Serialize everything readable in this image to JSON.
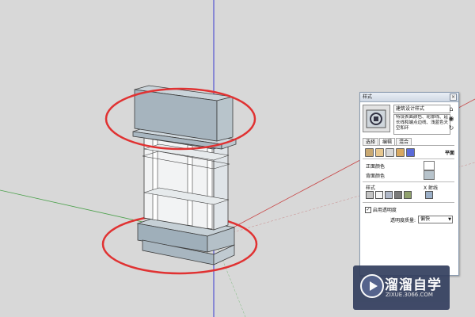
{
  "panel": {
    "title": "样式",
    "close_glyph": "×",
    "style_name": "建筑设计样式",
    "style_desc": "特设表面颜色、轮廓线、延长线和端点边线、浅蓝色天空和环",
    "tabs": [
      "选择",
      "编辑",
      "混合"
    ],
    "active_tab": "编辑",
    "flat_label": "平面",
    "front_color_label": "正面颜色",
    "back_color_label": "背面颜色",
    "style_label": "样式",
    "xray_label": "X 射线",
    "transparency_checkbox_label": "启用透明度",
    "transparency_quality_label": "透明度质量:",
    "transparency_quality_value": "偏快",
    "front_color": "#ffffff",
    "back_color": "#b7c3cb"
  },
  "watermark": {
    "title": "溜溜自学",
    "url": "ZIXUE.3066.COM"
  },
  "colors": {
    "viewport": "#d8d8d8",
    "model_face": "#a6b4be",
    "model_glass": "#f2f2f2",
    "highlight_ellipse": "#e03030",
    "axis_blue": "#3232c8",
    "axis_red": "#cc3b3b",
    "axis_green": "#3a9a3a"
  }
}
